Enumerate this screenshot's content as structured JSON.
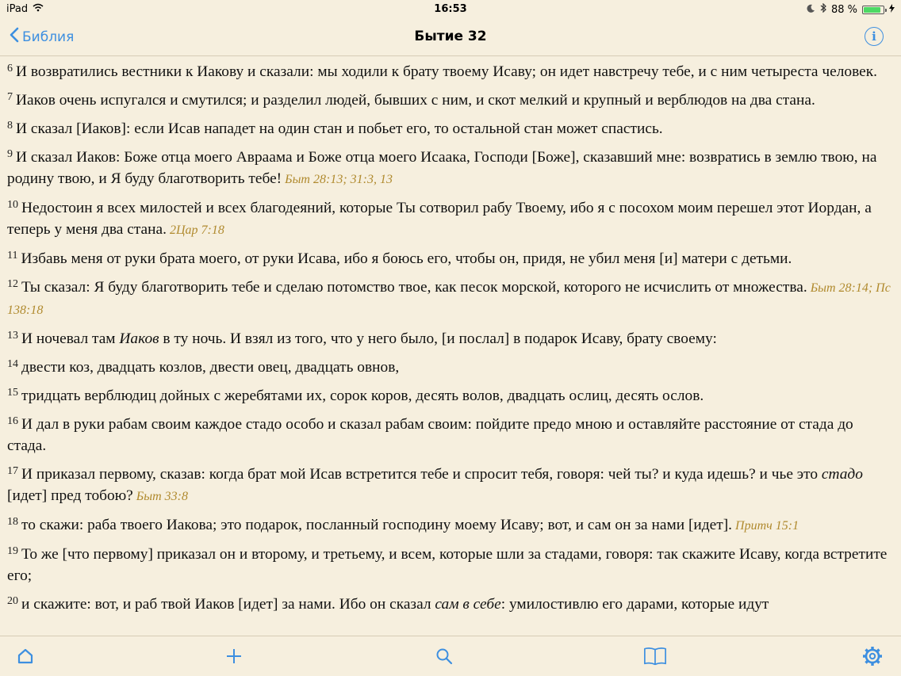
{
  "status": {
    "device": "iPad",
    "time": "16:53",
    "battery": "88 %"
  },
  "nav": {
    "back_label": "Библия",
    "title": "Бытие 32"
  },
  "colors": {
    "accent": "#3d8fe0",
    "background": "#f6efde",
    "reference": "#b08a2e"
  },
  "verses": [
    {
      "num": "6",
      "parts": [
        {
          "t": "И возвратились вестники к Иакову и сказали: мы ходили к брату твоему Исаву; он идет навстречу тебе, и с ним четыреста человек."
        }
      ],
      "ref": ""
    },
    {
      "num": "7",
      "parts": [
        {
          "t": "Иаков очень испугался и смутился; и разделил людей, бывших с ним, и скот мелкий и крупный и верблюдов на два стана."
        }
      ],
      "ref": ""
    },
    {
      "num": "8",
      "parts": [
        {
          "t": "И сказал [Иаков]: если Исав нападет на один стан и побьет его, то остальной стан может спастись."
        }
      ],
      "ref": ""
    },
    {
      "num": "9",
      "parts": [
        {
          "t": "И сказал Иаков: Боже отца моего Авраама и Боже отца моего Исаака, Господи [Боже], сказавший мне: возвратись в землю твою, на родину твою, и Я буду благотворить тебе!"
        }
      ],
      "ref": "Быт 28:13; 31:3, 13"
    },
    {
      "num": "10",
      "parts": [
        {
          "t": "Недостоин я всех милостей и всех благодеяний, которые Ты сотворил рабу Твоему, ибо я с посохом моим перешел этот Иордан, а теперь у меня два стана."
        }
      ],
      "ref": "2Цар 7:18"
    },
    {
      "num": "11",
      "parts": [
        {
          "t": "Избавь меня от руки брата моего, от руки Исава, ибо я боюсь его, чтобы он, придя, не убил меня [и] матери с детьми."
        }
      ],
      "ref": ""
    },
    {
      "num": "12",
      "parts": [
        {
          "t": "Ты сказал: Я буду благотворить тебе и сделаю потомство твое, как песок морской, которого не исчислить от множества."
        }
      ],
      "ref": "Быт 28:14; Пс 138:18"
    },
    {
      "num": "13",
      "parts": [
        {
          "t": "И ночевал там "
        },
        {
          "t": "Иаков",
          "i": true
        },
        {
          "t": " в ту ночь. И взял из того, что у него было, [и послал] в подарок Исаву, брату своему:"
        }
      ],
      "ref": ""
    },
    {
      "num": "14",
      "parts": [
        {
          "t": "двести коз, двадцать козлов, двести овец, двадцать овнов,"
        }
      ],
      "ref": ""
    },
    {
      "num": "15",
      "parts": [
        {
          "t": "тридцать верблюдиц дойных с жеребятами их, сорок коров, десять волов, двадцать ослиц, десять ослов."
        }
      ],
      "ref": ""
    },
    {
      "num": "16",
      "parts": [
        {
          "t": "И дал в руки рабам своим каждое стадо особо и сказал рабам своим: пойдите предо мною и оставляйте расстояние от стада до стада."
        }
      ],
      "ref": ""
    },
    {
      "num": "17",
      "parts": [
        {
          "t": "И приказал первому, сказав: когда брат мой Исав встретится тебе и спросит тебя, говоря: чей ты? и куда идешь? и чье это "
        },
        {
          "t": "стадо",
          "i": true
        },
        {
          "t": " [идет] пред тобою?"
        }
      ],
      "ref": "Быт 33:8"
    },
    {
      "num": "18",
      "parts": [
        {
          "t": "то скажи: раба твоего Иакова; это подарок, посланный господину моему Исаву; вот, и сам он за нами [идет]."
        }
      ],
      "ref": "Притч 15:1"
    },
    {
      "num": "19",
      "parts": [
        {
          "t": "То же [что первому] приказал он и второму, и третьему, и всем, которые шли за стадами, говоря: так скажите Исаву, когда встретите его;"
        }
      ],
      "ref": ""
    },
    {
      "num": "20",
      "parts": [
        {
          "t": "и скажите: вот, и раб твой Иаков [идет] за нами. Ибо он сказал "
        },
        {
          "t": "сам в себе",
          "i": true
        },
        {
          "t": ": умилостивлю его дарами, которые идут"
        }
      ],
      "ref": ""
    }
  ],
  "tabs": [
    {
      "name": "home-icon",
      "active": true
    },
    {
      "name": "add-icon"
    },
    {
      "name": "search-icon"
    },
    {
      "name": "book-icon"
    },
    {
      "name": "settings-icon"
    }
  ]
}
